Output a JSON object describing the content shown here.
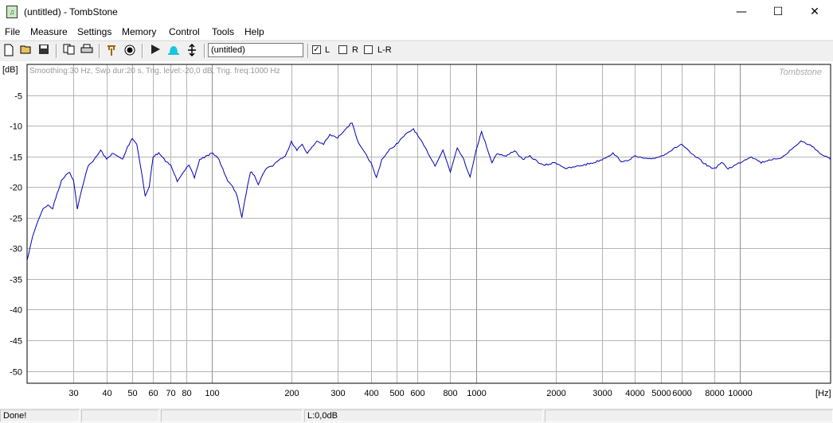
{
  "window": {
    "title": "(untitled) - TombStone",
    "minimize": "—",
    "maximize": "☐",
    "close": "✕"
  },
  "menu": [
    "File",
    "Measure",
    "Settings",
    "Memory",
    "Control",
    "Tools",
    "Help"
  ],
  "toolbar": {
    "measurement_name": "(untitled)",
    "channels": [
      {
        "label": "L",
        "checked": true
      },
      {
        "label": "R",
        "checked": false
      },
      {
        "label": "L-R",
        "checked": false
      }
    ]
  },
  "chart_data": {
    "type": "line",
    "info_text": "Smoothing:30 Hz, Swp dur:20 s, Trig. level:-20,0 dB, Trig. freq:1000 Hz",
    "watermark": "Tombstone",
    "ylabel": "[dB]",
    "xlabel": "[Hz]",
    "xscale": "log",
    "xlim": [
      20,
      22000
    ],
    "ylim": [
      -52,
      0
    ],
    "grid": true,
    "yticks": [
      -5,
      -10,
      -15,
      -20,
      -25,
      -30,
      -35,
      -40,
      -45,
      -50
    ],
    "xticks": [
      30,
      40,
      50,
      60,
      70,
      80,
      100,
      200,
      300,
      400,
      500,
      600,
      800,
      1000,
      2000,
      3000,
      4000,
      5000,
      6000,
      8000,
      10000
    ],
    "color": "#0000b4",
    "series": [
      {
        "x": [
          20,
          21,
          22,
          23,
          24,
          25,
          26,
          27,
          28,
          29,
          30,
          31,
          32,
          34,
          36,
          38,
          40,
          42,
          44,
          46,
          48,
          50,
          52,
          54,
          56,
          58,
          60,
          63,
          66,
          70,
          74,
          78,
          82,
          86,
          90,
          95,
          100,
          105,
          110,
          115,
          120,
          125,
          130,
          135,
          140,
          145,
          150,
          160,
          170,
          180,
          190,
          200,
          210,
          220,
          230,
          240,
          250,
          265,
          280,
          300,
          320,
          340,
          360,
          380,
          400,
          420,
          440,
          470,
          500,
          540,
          580,
          620,
          660,
          700,
          750,
          800,
          850,
          900,
          950,
          1000,
          1050,
          1100,
          1150,
          1200,
          1300,
          1400,
          1500,
          1600,
          1800,
          2000,
          2200,
          2500,
          2800,
          3000,
          3300,
          3600,
          4000,
          4500,
          5000,
          5500,
          6000,
          6500,
          7000,
          7500,
          8000,
          8500,
          9000,
          9500,
          10000,
          11000,
          12000,
          13000,
          14000,
          15000,
          16000,
          17000,
          18000,
          19000,
          20000,
          22000
        ],
        "y": [
          -32,
          -28,
          -25.5,
          -23.5,
          -23,
          -23.5,
          -21,
          -19,
          -18,
          -17.5,
          -19,
          -23.5,
          -21,
          -16.5,
          -15.5,
          -14,
          -15.5,
          -14.5,
          -15,
          -15.5,
          -13.5,
          -12,
          -13,
          -17,
          -21.5,
          -20,
          -15,
          -14.5,
          -15.5,
          -16.5,
          -19,
          -17.5,
          -16.5,
          -18.5,
          -15.5,
          -15,
          -14.5,
          -15,
          -17,
          -19,
          -20,
          -21.5,
          -25,
          -21,
          -17.5,
          -18,
          -19.5,
          -17,
          -16.5,
          -15.5,
          -15,
          -12.5,
          -14,
          -13,
          -14.5,
          -13.5,
          -12.5,
          -13,
          -11.5,
          -12,
          -10.5,
          -9.5,
          -13,
          -14.5,
          -16,
          -18.5,
          -15.5,
          -14,
          -13,
          -11.5,
          -10.5,
          -12.5,
          -14.5,
          -16.5,
          -14,
          -17.5,
          -13.5,
          -15.5,
          -18.5,
          -14,
          -11,
          -13.5,
          -16,
          -14.5,
          -15,
          -14,
          -15.5,
          -15,
          -16.5,
          -16,
          -17,
          -16.5,
          -16,
          -15.5,
          -14.5,
          -16,
          -15,
          -15.5,
          -15,
          -14,
          -13,
          -14.5,
          -15.5,
          -16.5,
          -17,
          -16,
          -17,
          -16.5,
          -16,
          -15,
          -16,
          -15.5,
          -15.5,
          -14.5,
          -13.5,
          -12.5,
          -13,
          -13.5,
          -14.5,
          -15.5
        ]
      }
    ]
  },
  "status": {
    "message": "Done!",
    "cell2": "",
    "cell3": "",
    "level": "L:0,0dB",
    "cell5": ""
  }
}
